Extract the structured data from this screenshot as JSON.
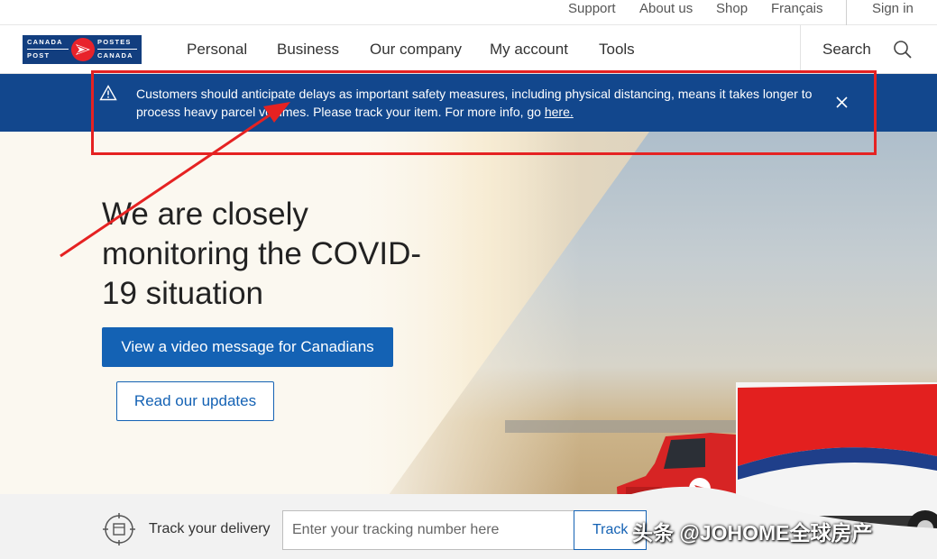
{
  "utility_nav": {
    "support": "Support",
    "about": "About us",
    "shop": "Shop",
    "french": "Français",
    "sign_in": "Sign in"
  },
  "logo": {
    "top_left": "CANADA",
    "top_right": "POSTES",
    "bottom_left": "POST",
    "bottom_right": "CANADA"
  },
  "main_nav": {
    "items": [
      "Personal",
      "Business",
      "Our company",
      "My account",
      "Tools"
    ],
    "search_label": "Search"
  },
  "alert": {
    "message": "Customers should anticipate delays as important safety measures, including physical distancing, means it takes longer to process heavy parcel volumes. Please track your item. For more info, go ",
    "link_text": "here."
  },
  "hero": {
    "headline": "We are closely monitoring the COVID-19 situation",
    "primary_button": "View a video message for Canadians",
    "secondary_button": "Read our updates"
  },
  "track": {
    "label": "Track your delivery",
    "placeholder": "Enter your tracking number here",
    "button": "Track"
  },
  "watermark": "头条 @JOHOME全球房产",
  "colors": {
    "brand_blue": "#12478d",
    "button_blue": "#1462b4",
    "brand_red": "#e8232b",
    "annotation_red": "#e52222"
  }
}
